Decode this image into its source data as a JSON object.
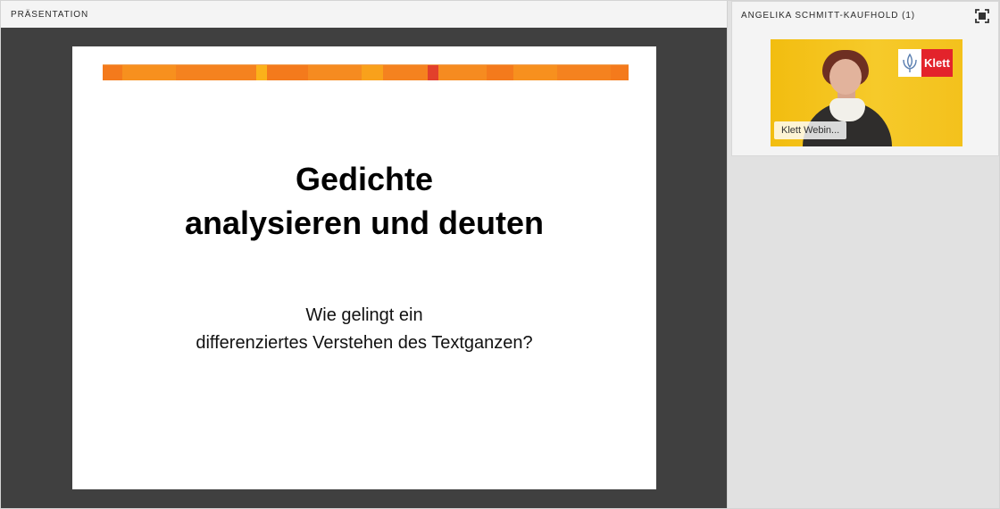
{
  "presentation_pod": {
    "title": "PRÄSENTATION"
  },
  "slide": {
    "title_line1": "Gedichte",
    "title_line2": "analysieren und deuten",
    "subtitle_line1": "Wie gelingt ein",
    "subtitle_line2": "differenziertes Verstehen des Textganzen?"
  },
  "camera_pod": {
    "title": "ANGELIKA SCHMITT-KAUFHOLD (1)",
    "fullscreen_icon": "fullscreen-icon",
    "video_label": "Klett Webin...",
    "logo_text": "Klett"
  },
  "colors": {
    "stage_background": "#404040",
    "slide_bar_orange": "#f5821f",
    "klett_red": "#e3232b",
    "video_background": "#f4c418"
  }
}
